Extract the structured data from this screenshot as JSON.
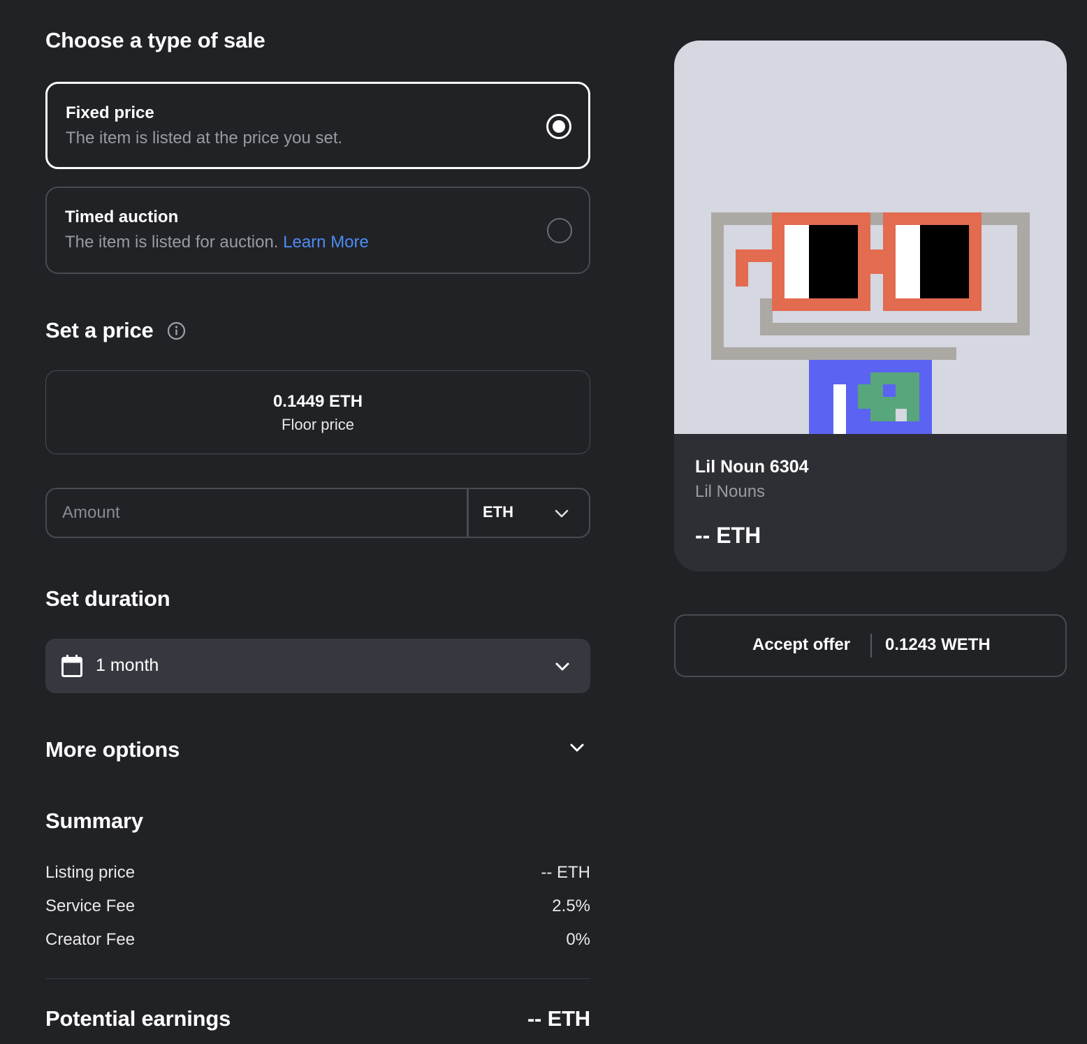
{
  "sale_type": {
    "heading": "Choose a type of sale",
    "fixed": {
      "title": "Fixed price",
      "desc": "The item is listed at the price you set.",
      "selected": true
    },
    "auction": {
      "title": "Timed auction",
      "desc": "The item is listed for auction.",
      "link": "Learn More",
      "selected": false
    }
  },
  "price": {
    "heading": "Set a price",
    "floor_value": "0.1449 ETH",
    "floor_label": "Floor price",
    "amount_placeholder": "Amount",
    "amount_value": "",
    "currency": "ETH"
  },
  "duration": {
    "heading": "Set duration",
    "value": "1 month"
  },
  "more_options": {
    "label": "More options"
  },
  "summary": {
    "heading": "Summary",
    "rows": [
      {
        "label": "Listing price",
        "value": "-- ETH"
      },
      {
        "label": "Service Fee",
        "value": "2.5%"
      },
      {
        "label": "Creator Fee",
        "value": "0%"
      }
    ],
    "earnings_label": "Potential earnings",
    "earnings_value": "-- ETH"
  },
  "nft": {
    "name": "Lil Noun 6304",
    "collection": "Lil Nouns",
    "price": "-- ETH"
  },
  "accept_offer": {
    "label": "Accept offer",
    "value": "0.1243 WETH"
  },
  "colors": {
    "background": "#212226",
    "link": "#4c8cf5",
    "nft_background": "#d5d7e1",
    "glasses": "#e26b50",
    "body": "#5b63f2",
    "body_pattern": "#58a67c"
  }
}
